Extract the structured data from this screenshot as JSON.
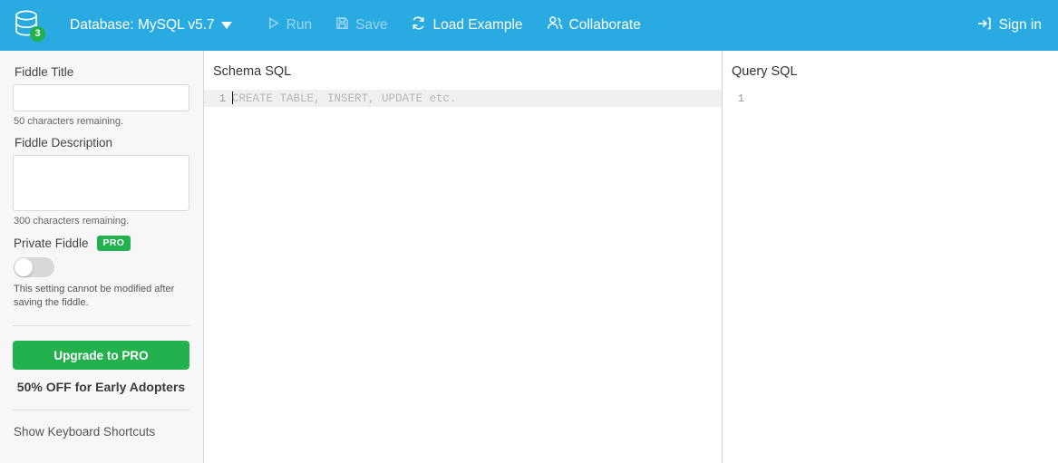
{
  "header": {
    "logo_icon": "database-icon",
    "version_badge": "3",
    "db_selector_label": "Database: MySQL v5.7",
    "actions": [
      {
        "label": "Run",
        "icon": "play-icon",
        "disabled": true
      },
      {
        "label": "Save",
        "icon": "save-disk-icon",
        "disabled": true
      },
      {
        "label": "Load Example",
        "icon": "refresh-icon",
        "disabled": false
      },
      {
        "label": "Collaborate",
        "icon": "users-icon",
        "disabled": false
      }
    ],
    "signin_label": "Sign in",
    "signin_icon": "sign-in-arrow-icon",
    "bg_color": "#29ABE2"
  },
  "sidebar": {
    "title_label": "Fiddle Title",
    "title_value": "",
    "title_placeholder": "",
    "title_help": "50 characters remaining.",
    "description_label": "Fiddle Description",
    "description_value": "",
    "description_placeholder": "",
    "description_help": "300 characters remaining.",
    "private_label": "Private Fiddle",
    "private_badge": "PRO",
    "private_toggle_state": "off",
    "private_note": "This setting cannot be modified after saving the fiddle.",
    "upgrade_button": "Upgrade to PRO",
    "offer_text": "50% OFF for Early Adopters",
    "shortcuts_link": "Show Keyboard Shortcuts",
    "accent_green": "#22B14C",
    "bg_color": "#f7f7f7"
  },
  "schema_panel": {
    "title": "Schema SQL",
    "lines": [
      {
        "number": "1",
        "placeholder": "CREATE TABLE, INSERT, UPDATE etc.",
        "active": true
      }
    ]
  },
  "query_panel": {
    "title": "Query SQL",
    "lines": [
      {
        "number": "1",
        "placeholder": "",
        "active": false
      }
    ]
  }
}
